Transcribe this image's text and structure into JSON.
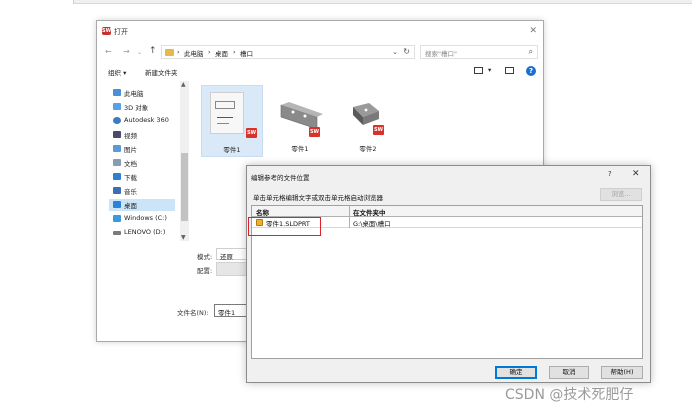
{
  "open_dialog": {
    "title": "打开",
    "nav": {
      "back": "←",
      "forward": "→",
      "up": "↑"
    },
    "address": {
      "crumb_pc": "此电脑",
      "crumb_desktop": "桌面",
      "crumb_folder": "槽口"
    },
    "search_placeholder": "搜索\"槽口\"",
    "toolbar": {
      "organize": "组织 ▾",
      "new_folder": "新建文件夹"
    },
    "sidebar": {
      "items": [
        {
          "label": "此电脑"
        },
        {
          "label": "3D 对象"
        },
        {
          "label": "Autodesk 360"
        },
        {
          "label": "视频"
        },
        {
          "label": "图片"
        },
        {
          "label": "文档"
        },
        {
          "label": "下载"
        },
        {
          "label": "音乐"
        },
        {
          "label": "桌面"
        },
        {
          "label": "Windows (C:)"
        },
        {
          "label": "LENOVO (D:)"
        }
      ]
    },
    "files": [
      {
        "label": "零件1"
      },
      {
        "label": "零件1"
      },
      {
        "label": "零件2"
      }
    ],
    "mode_label": "模式:",
    "mode_value": "还原",
    "config_label": "配置:",
    "filename_label": "文件名(N):",
    "filename_value": "零件1"
  },
  "ref_dialog": {
    "title": "编辑参考的文件位置",
    "help": "?",
    "close": "✕",
    "instruction": "单击单元格编辑文字或双击单元格启动浏览器",
    "browse_button": "浏览...",
    "columns": {
      "name": "名称",
      "folder": "在文件夹中"
    },
    "rows": [
      {
        "name": "零件1.SLDPRT",
        "folder": "G:\\桌面\\槽口"
      }
    ],
    "ok_button": "确定",
    "cancel_button": "取消",
    "help_button": "帮助(H)"
  },
  "watermark": "CSDN @技术死肥仔",
  "colors": {
    "highlight": "#e0202a",
    "selected": "#cce4f7",
    "accent": "#0078d7"
  }
}
